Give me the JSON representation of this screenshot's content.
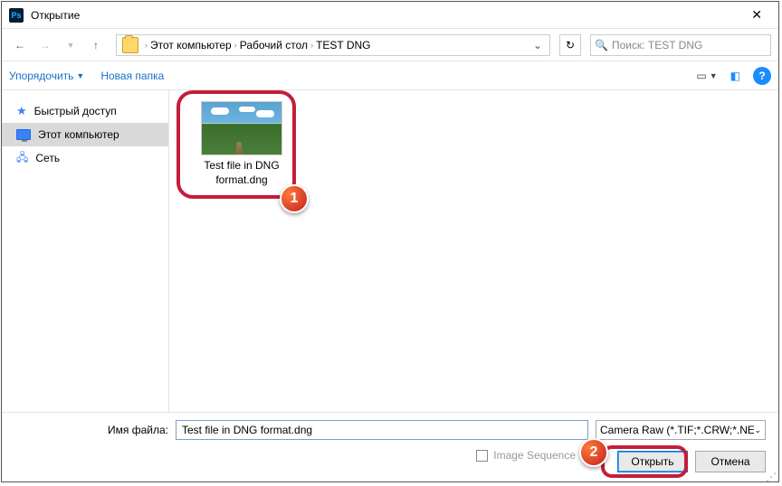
{
  "title": "Открытие",
  "breadcrumb": {
    "root": "Этот компьютер",
    "p2": "Рабочий стол",
    "p3": "TEST DNG"
  },
  "search_placeholder": "Поиск: TEST DNG",
  "toolbar": {
    "organize": "Упорядочить",
    "newfolder": "Новая папка"
  },
  "sidebar": {
    "quick": "Быстрый доступ",
    "thispc": "Этот компьютер",
    "network": "Сеть"
  },
  "file": {
    "caption": "Test file in DNG format.dng"
  },
  "footer": {
    "fname_label": "Имя файла:",
    "fname_value": "Test file in DNG format.dng",
    "filetype": "Camera Raw (*.TIF;*.CRW;*.NEF",
    "chk_label": "Image Sequence",
    "open": "Открыть",
    "cancel": "Отмена"
  },
  "markers": {
    "one": "1",
    "two": "2"
  }
}
